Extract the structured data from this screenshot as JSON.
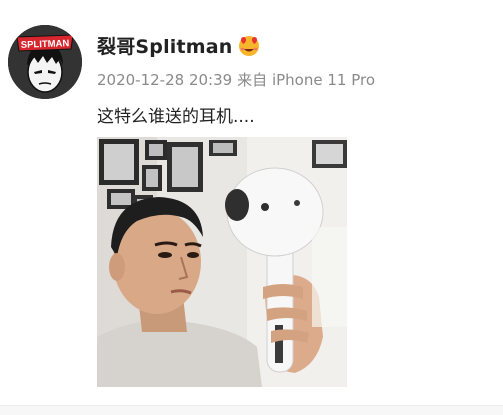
{
  "post": {
    "author": {
      "name": "裂哥Splitman",
      "avatar_text": "SPLITMAN",
      "badge_icon": "love-face-emoji-icon"
    },
    "timestamp": "2020-12-28 20:39",
    "source": "来自 iPhone 11 Pro",
    "text": "这特么谁送的耳机....",
    "image_icon": "photo-man-with-giant-airpod"
  },
  "colors": {
    "name": "#222222",
    "meta": "#8a8a8a",
    "text": "#222222",
    "avatar_bg": "#2d2d2d",
    "avatar_red": "#d8262e"
  }
}
